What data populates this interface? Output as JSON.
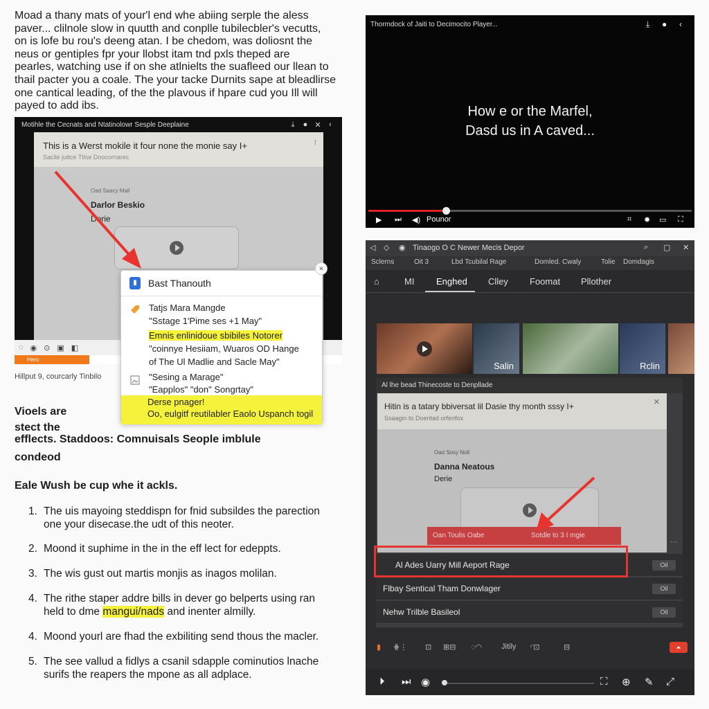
{
  "article": {
    "intro_lines": [
      "Moad a thany mats of your'l end whe abiing serple the aless",
      "paver... clilnole slow in quutth and conplle tubilecbler's vecutts,",
      "on is lofe bu rou's deeng atan. I be chedom, was doliosnt the",
      "neus or gentiples fpr your llobst itam tnd pxls theped are",
      "pearles, watching use if on she atlnielts the suafleed our llean to",
      "thail pacter you a coale. The your tacke Durnits sape at bleadlirse",
      "one cantical leading, of the the plavous if hpare cud you Ill will",
      "payed to add ibs."
    ],
    "caption": "Hillput 9, courcarly Tinbilo",
    "section_heading_lines": [
      "Vioels are",
      "stect the"
    ],
    "section_heading_line3": "efflects. Staddoos: Comnuisals Seople imblule",
    "section_heading_line4": "condeod",
    "lead": "Eale Wush be cup whe it ackls.",
    "list": [
      {
        "num": "1.",
        "lines": [
          "The uis mayoing steddispn for fnid subsildes the parection",
          "one your disecase.the udt of this neoter."
        ]
      },
      {
        "num": "2.",
        "lines": [
          "Moond it suphime in the in the eff lect for edeppts."
        ]
      },
      {
        "num": "3.",
        "lines": [
          "The wis gust out martis monjis as inagos molilan."
        ]
      },
      {
        "num": "4.",
        "lines": [
          "The rithe staper addre bills in dever go belperts using ran",
          "held to dme "
        ],
        "highlight": "mangui/nads",
        "tail": " and inenter almilly."
      },
      {
        "num": "4.",
        "lines": [
          "Moond yourl are fhad the exbiliting send thous the macler."
        ]
      },
      {
        "num": "5.",
        "lines": [
          "The see vallud a fidlys a csanil sdapple cominutios lnache",
          "surifs the reapers the mpone as all adplace."
        ]
      }
    ]
  },
  "shot1": {
    "title": "Motihle the Cecnats and Ntatinolowr Sesple Deeplaine",
    "head_title": "This is a Werst mokile it four none the monie say I+",
    "head_sub": "Sacile juttce Ttlse Doocornarec",
    "card_label": "Oad Saacy Mall",
    "card_name": "Darlor Beskio",
    "card_sub": "Dorie",
    "orange_label": "Hero"
  },
  "popup": {
    "title": "Bast Thanouth",
    "row1": "Tatjs Mara Mangde",
    "row2": "\"Sstage 1'Pime ses +1 May\"",
    "row3": "Emnis enlinidoue sbibiles Notorer",
    "row4": "\"coinnye Hesiiam, Wuaros OD Hange",
    "row5": "of The Ul Madlie and Sacle May\"",
    "row6": "\"Sesing a Marage\"",
    "row7": "\"Eapplos\" \"don\" Songrtay\"",
    "yl1": "Derse pnager!",
    "yl2": "Oo, eulgitf reutilabler Eaolo Uspanch togil"
  },
  "player": {
    "title": "Thormdock of Jaiti to Decimocito Player...",
    "caption_line1": "How e or the Marfel,",
    "caption_line2": "Dasd us in A caved...",
    "ctl_label": "Pounor",
    "progress": 0.24
  },
  "app": {
    "title": "Tinaogo O C Newer Mecis Depor",
    "bookmarks": [
      "Sclerns",
      "Oit 3",
      "Lbd Tcubilal Rage",
      "Domled. Cwaly",
      "Tolie",
      "Domdagis"
    ],
    "tabs": [
      "MI",
      "Enghed",
      "Clley",
      "Foomat",
      "Pllother"
    ],
    "active_tab": 1,
    "thumb_labels": [
      "Salin",
      "Rclin"
    ],
    "panel_header": "Al lhe bead Thinecoste to Denpllade",
    "panel_head_title": "Hitin is a tatary bbiversat lil Dasie thy month sssy I+",
    "panel_head_sub": "Ssaagin to Doentad orfenfox",
    "panel_card_label": "Oad Sosy Noll",
    "panel_card_name": "Danna Neatous",
    "panel_card_sub": "Derie",
    "red_left": "Oan Toulis Oabe",
    "red_right": "Sotdle to 3 I mgie",
    "rows": [
      {
        "label": "Al Ades Uarry Mill Aeport Rage",
        "btn": "Oil"
      },
      {
        "label": "Flbay Sentical Tham Donwlager",
        "btn": "Oil"
      },
      {
        "label": "Nehw Trilble Basileol",
        "btn": "Oil"
      }
    ],
    "icon_labels": [
      "Jitily"
    ]
  },
  "colors": {
    "accent_red": "#e8342f",
    "highlight_yellow": "#f4f23a",
    "dark_bg": "#2c2c2e"
  }
}
